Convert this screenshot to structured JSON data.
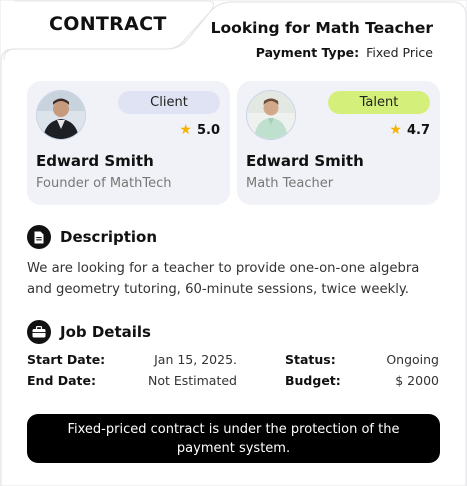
{
  "header": {
    "tab_title": "CONTRACT",
    "job_title": "Looking for Math Teacher",
    "payment_type_label": "Payment Type:",
    "payment_type_value": "Fixed Price"
  },
  "client": {
    "badge": "Client",
    "rating": "5.0",
    "name": "Edward Smith",
    "role": "Founder of MathTech"
  },
  "talent": {
    "badge": "Talent",
    "rating": "4.7",
    "name": "Edward Smith",
    "role": "Math Teacher"
  },
  "description": {
    "title": "Description",
    "text": "We are looking for a teacher to provide one-on-one algebra and geometry tutoring, 60-minute sessions, twice weekly."
  },
  "job_details": {
    "title": "Job Details",
    "start_date_label": "Start Date:",
    "start_date_value": "Jan 15, 2025.",
    "end_date_label": "End Date:",
    "end_date_value": "Not Estimated",
    "status_label": "Status:",
    "status_value": "Ongoing",
    "budget_label": "Budget:",
    "budget_value": "$ 2000"
  },
  "notice": "Fixed-priced contract is under the protection of the payment system.",
  "colors": {
    "client_badge": "#dfe3f3",
    "talent_badge": "#d5f07a",
    "star": "#f4b400",
    "notice_bg": "#000000"
  }
}
